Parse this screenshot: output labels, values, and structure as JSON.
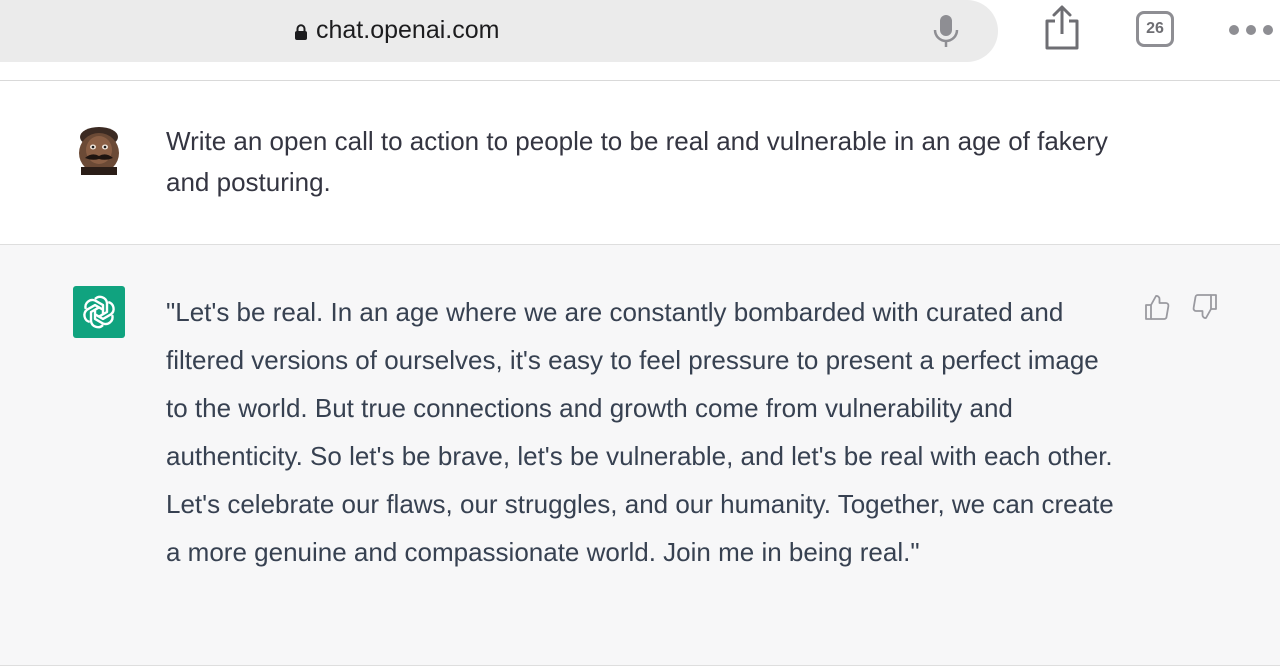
{
  "browser": {
    "url": "chat.openai.com",
    "tab_count": "26"
  },
  "conversation": {
    "user_message": "Write an open call to action to people to be real and vulnerable in an age of fakery and posturing.",
    "assistant_message": "\"Let's be real. In an age where we are constantly bombarded with curated and filtered versions of ourselves, it's easy to feel pressure to present a perfect image to the world. But true connections and growth come from vulnerability and authenticity. So let's be brave, let's be vulnerable, and let's be real with each other. Let's celebrate our flaws, our struggles, and our humanity. Together, we can create a more genuine and compassionate world. Join me in being real.\""
  },
  "icons": {
    "lock": "lock-icon",
    "mic": "microphone-icon",
    "share": "share-icon",
    "tabs": "tabs-icon",
    "more": "more-icon",
    "openai": "openai-logo-icon",
    "thumb_up": "thumbs-up-icon",
    "thumb_down": "thumbs-down-icon"
  },
  "colors": {
    "accent": "#10a37f",
    "assistant_bg": "#f7f7f8",
    "text": "#374151"
  }
}
